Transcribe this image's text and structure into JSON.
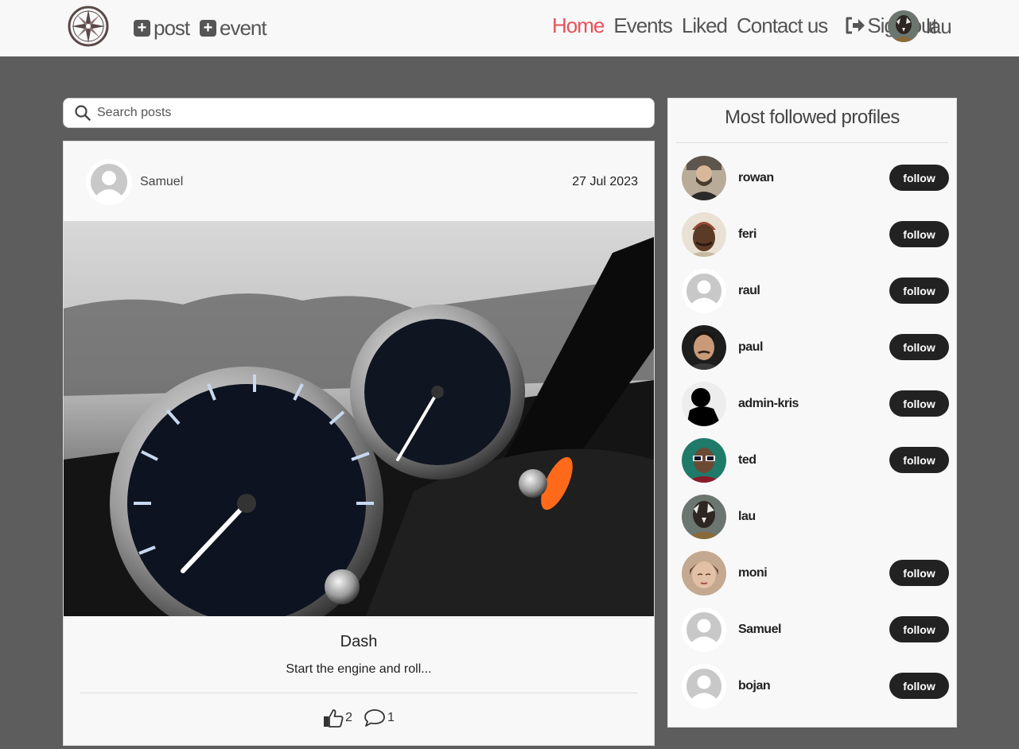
{
  "nav": {
    "add_post_label": "post",
    "add_event_label": "event",
    "links": [
      {
        "label": "Home",
        "active": true
      },
      {
        "label": "Events",
        "active": false
      },
      {
        "label": "Liked",
        "active": false
      },
      {
        "label": "Contact us",
        "active": false
      }
    ],
    "signout_label": "Sign out",
    "username": "lau"
  },
  "search": {
    "placeholder": "Search posts"
  },
  "post": {
    "author": "Samuel",
    "date": "27 Jul 2023",
    "title": "Dash",
    "excerpt": "Start the engine and roll...",
    "likes": "2",
    "comments": "1"
  },
  "profiles": {
    "title": "Most followed profiles",
    "follow_label": "follow",
    "items": [
      {
        "name": "rowan",
        "avatar": "photo-bearded-man",
        "follow": true
      },
      {
        "name": "feri",
        "avatar": "photo-man-beanie",
        "follow": true
      },
      {
        "name": "raul",
        "avatar": "default-avatar",
        "follow": true
      },
      {
        "name": "paul",
        "avatar": "photo-man-mustache",
        "follow": true
      },
      {
        "name": "admin-kris",
        "avatar": "photo-silhouette",
        "follow": true
      },
      {
        "name": "ted",
        "avatar": "photo-man-sunglasses",
        "follow": true
      },
      {
        "name": "lau",
        "avatar": "photo-painted-face",
        "follow": false
      },
      {
        "name": "moni",
        "avatar": "photo-woman",
        "follow": true
      },
      {
        "name": "Samuel",
        "avatar": "default-avatar",
        "follow": true
      },
      {
        "name": "bojan",
        "avatar": "default-avatar",
        "follow": true
      }
    ]
  },
  "colors": {
    "accent": "#e8505b",
    "nav_text": "#555555",
    "page_bg": "#5d5d5d",
    "card_bg": "#f8f8f8",
    "button_bg": "#222222"
  }
}
